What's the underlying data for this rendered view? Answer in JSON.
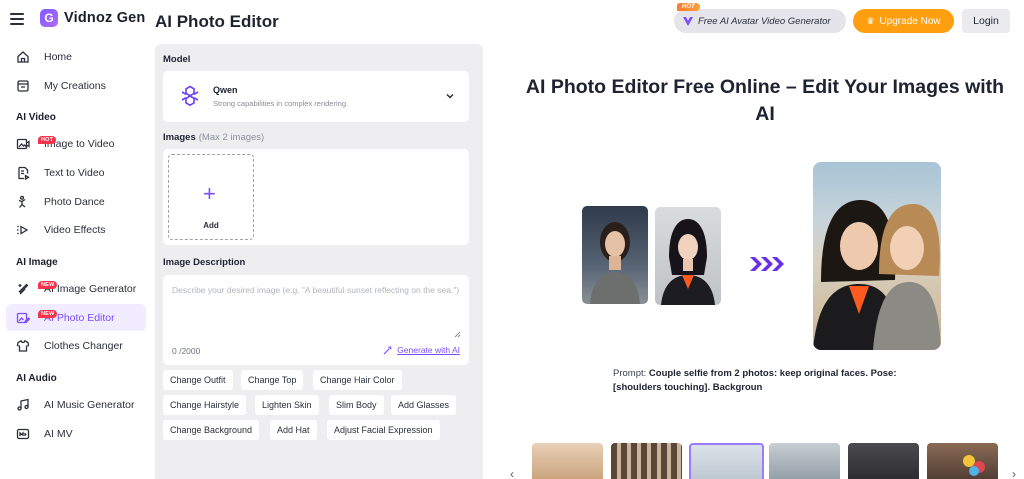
{
  "brand": {
    "name": "Vidnoz Gen"
  },
  "sidebar": {
    "items_top": [
      {
        "label": "Home",
        "icon": "home-icon"
      },
      {
        "label": "My Creations",
        "icon": "creations-icon"
      }
    ],
    "sections": [
      {
        "title": "AI Video",
        "items": [
          {
            "label": "Image to Video",
            "icon": "image-to-video-icon",
            "badge": "HOT"
          },
          {
            "label": "Text to Video",
            "icon": "text-to-video-icon"
          },
          {
            "label": "Photo Dance",
            "icon": "photo-dance-icon"
          },
          {
            "label": "Video Effects",
            "icon": "video-effects-icon"
          }
        ]
      },
      {
        "title": "AI Image",
        "items": [
          {
            "label": "AI Image Generator",
            "icon": "image-generator-icon",
            "badge": "NEW"
          },
          {
            "label": "AI Photo Editor",
            "icon": "photo-editor-icon",
            "badge": "NEW",
            "active": true
          },
          {
            "label": "Clothes Changer",
            "icon": "clothes-icon"
          }
        ]
      },
      {
        "title": "AI Audio",
        "items": [
          {
            "label": "AI Music Generator",
            "icon": "music-icon"
          },
          {
            "label": "AI MV",
            "icon": "mv-icon"
          }
        ]
      }
    ]
  },
  "header": {
    "page_title": "AI Photo Editor",
    "promo_tag": "HOT",
    "promo_label": "Free AI Avatar Video Generator",
    "upgrade_label": "Upgrade Now",
    "login_label": "Login"
  },
  "editor": {
    "model_label": "Model",
    "model_name": "Qwen",
    "model_desc": "Strong capabilities in complex rendering.",
    "images_label": "Images",
    "images_hint": "(Max 2 images)",
    "add_label": "Add",
    "description_label": "Image Description",
    "description_placeholder": "Describe your desired image (e.g. \"A beautiful sunset reflecting on the sea.\")",
    "description_value": "",
    "counter": "0 /2000",
    "generate_label": "Generate with AI",
    "chips": [
      [
        "Change Outfit",
        "Change Top",
        "Change Hair Color"
      ],
      [
        "Change Hairstyle",
        "Lighten Skin",
        "Slim Body",
        "Add Glasses"
      ],
      [
        "Change Background",
        "Add Hat",
        "Adjust Facial Expression"
      ]
    ]
  },
  "hero": {
    "title": "AI Photo Editor Free Online – Edit Your Images with AI",
    "prompt_label": "Prompt:",
    "prompt_text": "Couple selfie from 2 photos: keep original faces. Pose: [shoulders touching]. Backgroun"
  },
  "colors": {
    "accent": "#7c4dff",
    "upgrade": "#ff9f10",
    "hot": "#f5334a",
    "panel": "#eeeef1"
  }
}
